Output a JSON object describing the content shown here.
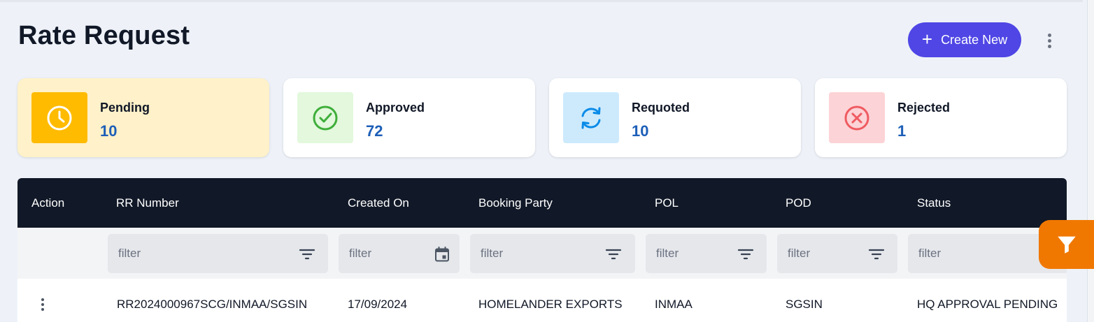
{
  "header": {
    "title": "Rate Request",
    "create_label": "Create New"
  },
  "colors": {
    "accent": "#4f46e5",
    "header_bg": "#111827",
    "value_text": "#1d5fb8",
    "filter_fab": "#f07800"
  },
  "stats": [
    {
      "label": "Pending",
      "value": "10",
      "icon": "clock-icon",
      "icon_bg": "#ffbb00",
      "card_bg": "#fff1c9"
    },
    {
      "label": "Approved",
      "value": "72",
      "icon": "check-circle-icon",
      "icon_bg": "#e3f8dc",
      "card_bg": "#ffffff"
    },
    {
      "label": "Requoted",
      "value": "10",
      "icon": "refresh-icon",
      "icon_bg": "#cdeafd",
      "card_bg": "#ffffff"
    },
    {
      "label": "Rejected",
      "value": "1",
      "icon": "x-circle-icon",
      "icon_bg": "#fcd3d6",
      "card_bg": "#ffffff"
    }
  ],
  "table": {
    "columns": [
      "Action",
      "RR Number",
      "Created On",
      "Booking Party",
      "POL",
      "POD",
      "Status"
    ],
    "filter_placeholder": "filter",
    "rows": [
      {
        "rr_number": "RR2024000967SCG/INMAA/SGSIN",
        "created_on": "17/09/2024",
        "booking_party": "HOMELANDER EXPORTS",
        "pol": "INMAA",
        "pod": "SGSIN",
        "status": "HQ APPROVAL PENDING"
      }
    ]
  }
}
